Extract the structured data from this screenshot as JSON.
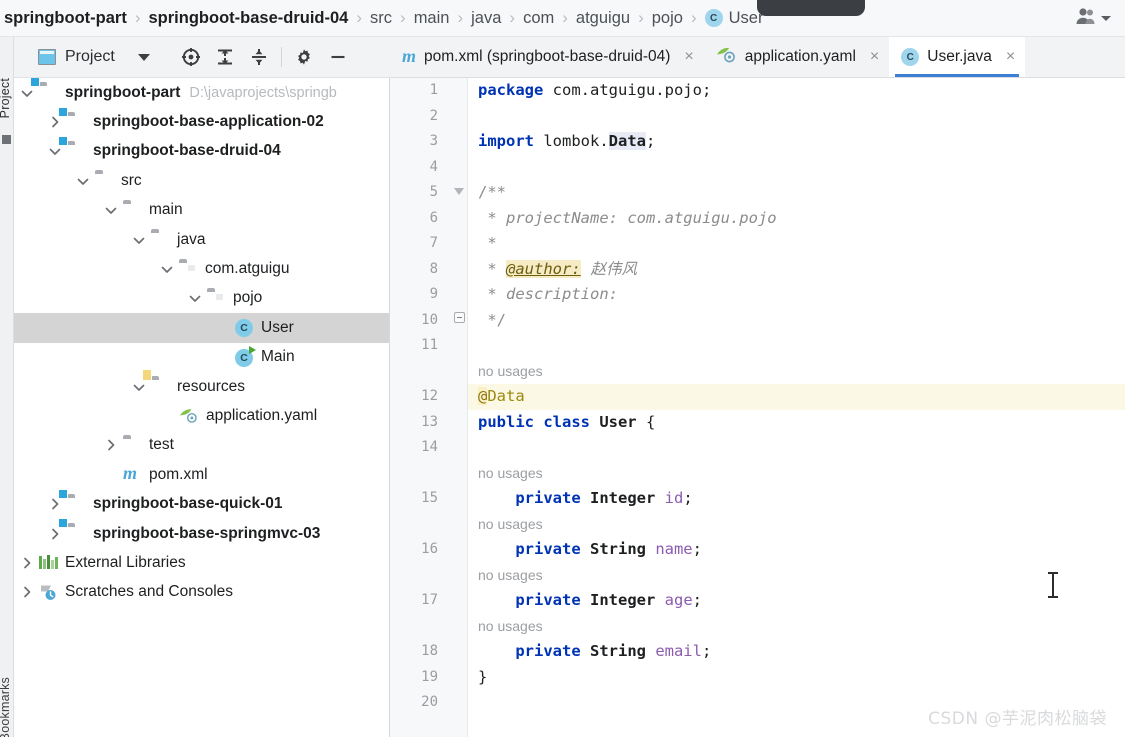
{
  "window": {
    "accent_color": "#3d7fd6",
    "watermark": "CSDN @芋泥肉松脑袋"
  },
  "breadcrumb": {
    "separator": "›",
    "items": [
      {
        "label": "springboot-part",
        "style": "bold",
        "icon": ""
      },
      {
        "label": "springboot-base-druid-04",
        "style": "bold",
        "icon": ""
      },
      {
        "label": "src",
        "style": "dim",
        "icon": ""
      },
      {
        "label": "main",
        "style": "dim",
        "icon": ""
      },
      {
        "label": "java",
        "style": "dim",
        "icon": ""
      },
      {
        "label": "com",
        "style": "dim",
        "icon": ""
      },
      {
        "label": "atguigu",
        "style": "dim",
        "icon": ""
      },
      {
        "label": "pojo",
        "style": "dim",
        "icon": ""
      },
      {
        "label": "User",
        "style": "dim",
        "icon": "class-badge",
        "badge": "C"
      }
    ],
    "account_icon": "people-icon"
  },
  "project_panel": {
    "title": "Project",
    "vertical_label": "Project",
    "vertical_label_bottom": "Bookmarks",
    "dropdown_icon": "chevron-down-icon",
    "actions": [
      {
        "name": "select-opened-file-icon",
        "label": ""
      },
      {
        "name": "expand-all-icon",
        "label": ""
      },
      {
        "name": "collapse-all-icon",
        "label": ""
      },
      {
        "name": "settings-gear-icon",
        "label": ""
      },
      {
        "name": "hide-panel-icon",
        "label": ""
      }
    ]
  },
  "tree": {
    "items": [
      {
        "label": "springboot-part",
        "hint": "D:\\javaprojects\\springb",
        "indent": 0,
        "arrow": "down",
        "icon": "module-folder",
        "bold": true,
        "selected": false
      },
      {
        "label": "springboot-base-application-02",
        "hint": "",
        "indent": 1,
        "arrow": "right",
        "icon": "module-folder",
        "bold": true,
        "selected": false
      },
      {
        "label": "springboot-base-druid-04",
        "hint": "",
        "indent": 1,
        "arrow": "down",
        "icon": "module-folder",
        "bold": true,
        "selected": false
      },
      {
        "label": "src",
        "hint": "",
        "indent": 2,
        "arrow": "down",
        "icon": "folder",
        "bold": false,
        "selected": false
      },
      {
        "label": "main",
        "hint": "",
        "indent": 3,
        "arrow": "down",
        "icon": "folder",
        "bold": false,
        "selected": false
      },
      {
        "label": "java",
        "hint": "",
        "indent": 4,
        "arrow": "down",
        "icon": "source-folder",
        "bold": false,
        "selected": false
      },
      {
        "label": "com.atguigu",
        "hint": "",
        "indent": 5,
        "arrow": "down",
        "icon": "package",
        "bold": false,
        "selected": false
      },
      {
        "label": "pojo",
        "hint": "",
        "indent": 6,
        "arrow": "down",
        "icon": "package",
        "bold": false,
        "selected": false
      },
      {
        "label": "User",
        "hint": "",
        "indent": 7,
        "arrow": "none",
        "icon": "java-class",
        "bold": false,
        "selected": true
      },
      {
        "label": "Main",
        "hint": "",
        "indent": 7,
        "arrow": "none",
        "icon": "java-class-run",
        "bold": false,
        "selected": false
      },
      {
        "label": "resources",
        "hint": "",
        "indent": 4,
        "arrow": "down",
        "icon": "resource-folder",
        "bold": false,
        "selected": false
      },
      {
        "label": "application.yaml",
        "hint": "",
        "indent": 5,
        "arrow": "none",
        "icon": "yaml-file",
        "bold": false,
        "selected": false
      },
      {
        "label": "test",
        "hint": "",
        "indent": 3,
        "arrow": "right",
        "icon": "folder",
        "bold": false,
        "selected": false
      },
      {
        "label": "pom.xml",
        "hint": "",
        "indent": 3,
        "arrow": "none",
        "icon": "maven-file",
        "bold": false,
        "selected": false
      },
      {
        "label": "springboot-base-quick-01",
        "hint": "",
        "indent": 1,
        "arrow": "right",
        "icon": "module-folder",
        "bold": true,
        "selected": false
      },
      {
        "label": "springboot-base-springmvc-03",
        "hint": "",
        "indent": 1,
        "arrow": "right",
        "icon": "module-folder",
        "bold": true,
        "selected": false
      },
      {
        "label": "External Libraries",
        "hint": "",
        "indent": 0,
        "arrow": "right",
        "icon": "libraries",
        "bold": false,
        "selected": false
      },
      {
        "label": "Scratches and Consoles",
        "hint": "",
        "indent": 0,
        "arrow": "right",
        "icon": "scratches",
        "bold": false,
        "selected": false
      }
    ]
  },
  "editor_tabs": {
    "close_glyph": "×",
    "items": [
      {
        "label": "pom.xml (springboot-base-druid-04)",
        "icon": "maven-file-icon",
        "active": false
      },
      {
        "label": "application.yaml",
        "icon": "yaml-file-icon",
        "active": false
      },
      {
        "label": "User.java",
        "icon": "java-class-icon",
        "active": true
      }
    ]
  },
  "code": {
    "file": "User.java",
    "current_line": 12,
    "usage_hint": "no usages",
    "author": "赵伟风",
    "lines": [
      {
        "n": 1,
        "text": "package com.atguigu.pojo;"
      },
      {
        "n": 2,
        "text": ""
      },
      {
        "n": 3,
        "text": "import lombok.Data;"
      },
      {
        "n": 4,
        "text": ""
      },
      {
        "n": 5,
        "text": "/**"
      },
      {
        "n": 6,
        "text": " * projectName: com.atguigu.pojo"
      },
      {
        "n": 7,
        "text": " *"
      },
      {
        "n": 8,
        "text": " * @author: 赵伟风"
      },
      {
        "n": 9,
        "text": " * description:"
      },
      {
        "n": 10,
        "text": " */"
      },
      {
        "n": 11,
        "text": ""
      },
      {
        "n": 12,
        "text": "@Data"
      },
      {
        "n": 13,
        "text": "public class User {"
      },
      {
        "n": 14,
        "text": ""
      },
      {
        "n": 15,
        "text": "    private Integer id;"
      },
      {
        "n": 16,
        "text": "    private String name;"
      },
      {
        "n": 17,
        "text": "    private Integer age;"
      },
      {
        "n": 18,
        "text": "    private String email;"
      },
      {
        "n": 19,
        "text": "}"
      },
      {
        "n": 20,
        "text": ""
      }
    ]
  }
}
